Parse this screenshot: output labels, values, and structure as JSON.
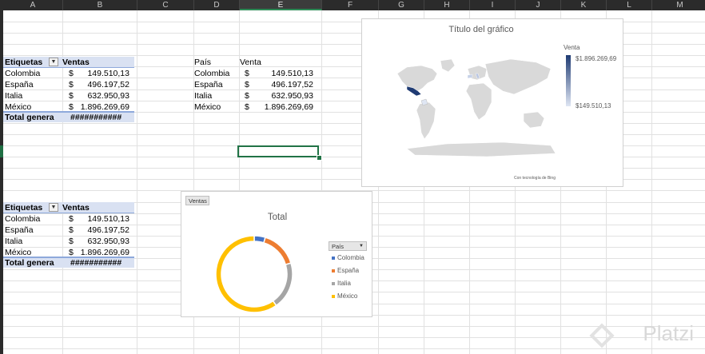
{
  "columns": [
    "A",
    "B",
    "C",
    "D",
    "E",
    "F",
    "G",
    "H",
    "I",
    "J",
    "K",
    "L",
    "M"
  ],
  "selected_column": "E",
  "pivot1": {
    "header_label": "Etiquetas",
    "header_values": "Ventas",
    "rows": [
      {
        "country": "Colombia",
        "currency": "$",
        "value": "149.510,13"
      },
      {
        "country": "España",
        "currency": "$",
        "value": "496.197,52"
      },
      {
        "country": "Italia",
        "currency": "$",
        "value": "632.950,93"
      },
      {
        "country": "México",
        "currency": "$",
        "value": "1.896.269,69"
      }
    ],
    "total_label": "Total genera",
    "total_value": "###########"
  },
  "table2": {
    "header_country": "País",
    "header_sales": "Venta",
    "rows": [
      {
        "country": "Colombia",
        "currency": "$",
        "value": "149.510,13"
      },
      {
        "country": "España",
        "currency": "$",
        "value": "496.197,52"
      },
      {
        "country": "Italia",
        "currency": "$",
        "value": "632.950,93"
      },
      {
        "country": "México",
        "currency": "$",
        "value": "1.896.269,69"
      }
    ]
  },
  "pivot2": {
    "header_label": "Etiquetas",
    "header_values": "Ventas",
    "rows": [
      {
        "country": "Colombia",
        "currency": "$",
        "value": "149.510,13"
      },
      {
        "country": "España",
        "currency": "$",
        "value": "496.197,52"
      },
      {
        "country": "Italia",
        "currency": "$",
        "value": "632.950,93"
      },
      {
        "country": "México",
        "currency": "$",
        "value": "1.896.269,69"
      }
    ],
    "total_label": "Total genera",
    "total_value": "###########"
  },
  "map_chart": {
    "title": "Título del gráfico",
    "legend_title": "Venta",
    "legend_max": "$1.896.269,69",
    "legend_min": "$149.510,13",
    "credit": "Con tecnología de Bing",
    "colors": {
      "high": "#1f3b73",
      "low": "#dfe6f3",
      "land": "#d9d9d9"
    }
  },
  "chart_data": {
    "type": "pie",
    "title": "Total",
    "field_button": "Ventas",
    "legend_filter": "País",
    "categories": [
      "Colombia",
      "España",
      "Italia",
      "México"
    ],
    "values": [
      149510.13,
      496197.52,
      632950.93,
      1896269.69
    ],
    "colors": [
      "#4472c4",
      "#ed7d31",
      "#a5a5a5",
      "#ffc000"
    ],
    "legend_position": "right"
  },
  "watermark": "Platzi"
}
